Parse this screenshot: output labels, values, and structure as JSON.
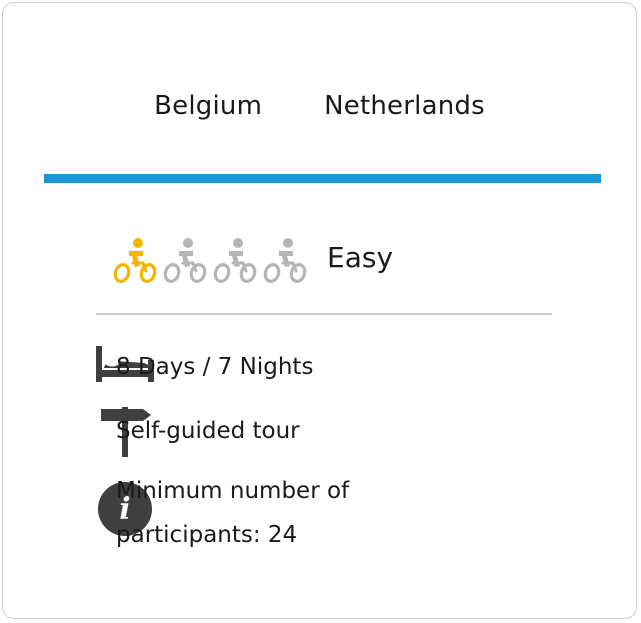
{
  "destinations": {
    "items": [
      "Belgium",
      "Netherlands"
    ]
  },
  "colors": {
    "accent_bar": "#1b96d6",
    "bike_active": "#f2b600",
    "bike_inactive": "#b5b5b5",
    "icon_dark": "#3f3f3f",
    "divider": "#cccccc"
  },
  "difficulty": {
    "level": 1,
    "max": 4,
    "label": "Easy",
    "icon": "cyclist-icon"
  },
  "details": [
    {
      "icon": "bed-icon",
      "text": "8 Days / 7 Nights"
    },
    {
      "icon": "signpost-icon",
      "text": "Self-guided tour"
    },
    {
      "icon": "info-icon",
      "text": "Minimum number of participants: 24"
    }
  ]
}
